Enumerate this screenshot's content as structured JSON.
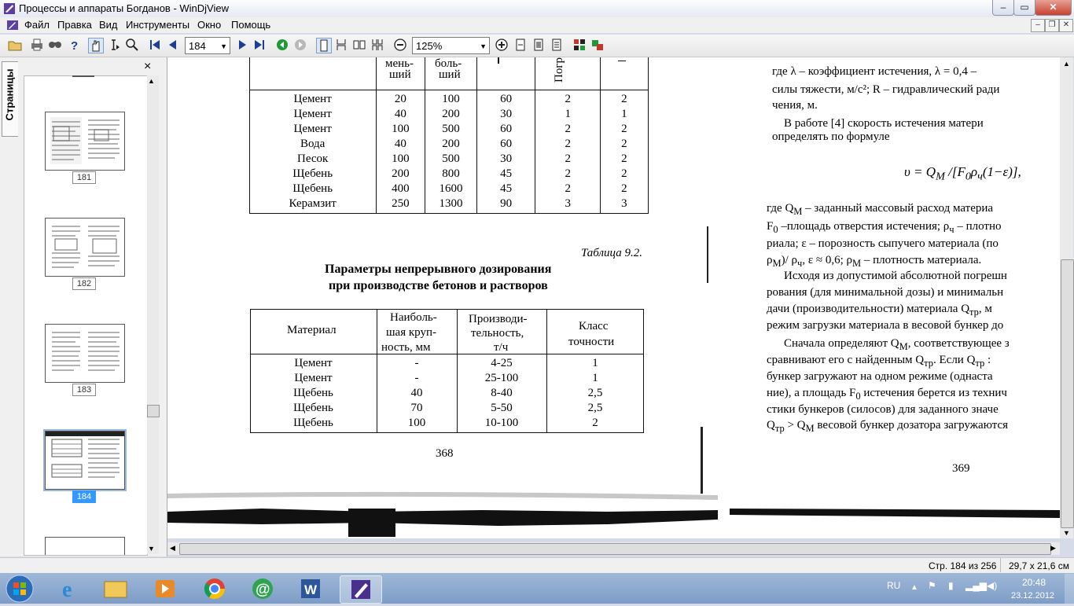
{
  "window": {
    "title": "Процессы и аппараты Богданов - WinDjView",
    "controls": {
      "minimize": "–",
      "maximize": "▭",
      "close": "✕"
    }
  },
  "menu": {
    "items": [
      "Файл",
      "Правка",
      "Вид",
      "Инструменты",
      "Окно",
      "Помощь"
    ]
  },
  "toolbar": {
    "page_value": "184",
    "zoom_value": "125%"
  },
  "sidebar": {
    "tab_label": "Страницы",
    "close_label": "×",
    "thumbnails": [
      {
        "label": "181",
        "selected": false
      },
      {
        "label": "182",
        "selected": false
      },
      {
        "label": "183",
        "selected": false
      },
      {
        "label": "184",
        "selected": true
      }
    ]
  },
  "document": {
    "left_page": {
      "table1": {
        "header_fragments": [
          "мень-",
          "ший",
          "боль-",
          "ший",
          "Погр"
        ],
        "rows": [
          [
            "Цемент",
            "20",
            "100",
            "60",
            "2",
            "2"
          ],
          [
            "Цемент",
            "40",
            "200",
            "30",
            "1",
            "1"
          ],
          [
            "Цемент",
            "100",
            "500",
            "60",
            "2",
            "2"
          ],
          [
            "Вода",
            "40",
            "200",
            "60",
            "2",
            "2"
          ],
          [
            "Песок",
            "100",
            "500",
            "30",
            "2",
            "2"
          ],
          [
            "Щебень",
            "200",
            "800",
            "45",
            "2",
            "2"
          ],
          [
            "Щебень",
            "400",
            "1600",
            "45",
            "2",
            "2"
          ],
          [
            "Керамзит",
            "250",
            "1300",
            "90",
            "3",
            "3"
          ]
        ]
      },
      "table2_caption": "Таблица 9.2.",
      "table2_title_line1": "Параметры непрерывного дозирования",
      "table2_title_line2": "при производстве бетонов и растворов",
      "table2": {
        "headers": [
          [
            "Материал"
          ],
          [
            "Наиболь-",
            "шая круп-",
            "ность, мм"
          ],
          [
            "Производи-",
            "тельность,",
            "т/ч"
          ],
          [
            "Класс",
            "точности"
          ]
        ],
        "rows": [
          [
            "Цемент",
            "-",
            "4-25",
            "1"
          ],
          [
            "Цемент",
            "-",
            "25-100",
            "1"
          ],
          [
            "Щебень",
            "40",
            "8-40",
            "2,5"
          ],
          [
            "Щебень",
            "70",
            "5-50",
            "2,5"
          ],
          [
            "Щебень",
            "100",
            "10-100",
            "2"
          ]
        ]
      },
      "page_number": "368"
    },
    "right_page": {
      "lines": [
        "где λ – коэффициент истечения, λ = 0,4 –",
        "силы тяжести, м/с²; R – гидравлический ради",
        "чения, м.",
        "В работе [4] скорость истечения матери",
        "определять по формуле",
        "υ = Q<sub>M</sub> /[F<sub>0</sub>ρ<sub>ч</sub>(1−ε)],",
        "где Q<sub>M</sub> – заданный массовый расход материа",
        "F<sub>0</sub> –площадь отверстия истечения; ρ<sub>ч</sub> – плотно",
        "риала; ε – порозность сыпучего материала (по",
        "ρ<sub>M</sub>)/ ρ<sub>ч</sub>, ε ≈ 0,6; ρ<sub>M</sub> – плотность материала.",
        "Исходя из допустимой абсолютной погрешн",
        "рования (для минимальной дозы) и минимальн",
        "дачи (производительности) материала Q<sub>тр</sub>, м",
        "режим загрузки материала в весовой бункер до",
        "Сначала определяют Q<sub>M</sub>, соответствующее з",
        "сравнивают его с найденным Q<sub>тр</sub>. Если Q<sub>тр</sub> :",
        "бункер загружают на одном режиме (однаста",
        "ние), а площадь F<sub>0</sub> истечения берется из технич",
        "стики бункеров (силосов) для заданного значе",
        "Q<sub>тр</sub> &gt; Q<sub>M</sub> весовой бункер дозатора загружаются"
      ],
      "page_number": "369"
    }
  },
  "statusbar": {
    "page_info": "Стр. 184 из 256",
    "page_size": "29,7 x 21,6 см"
  },
  "taskbar": {
    "language": "RU",
    "time": "20:48",
    "date": "23.12.2012"
  },
  "colors": {
    "selection": "#3399ff",
    "taskbar": "#7d9cc6",
    "close_button": "#c7402d"
  }
}
